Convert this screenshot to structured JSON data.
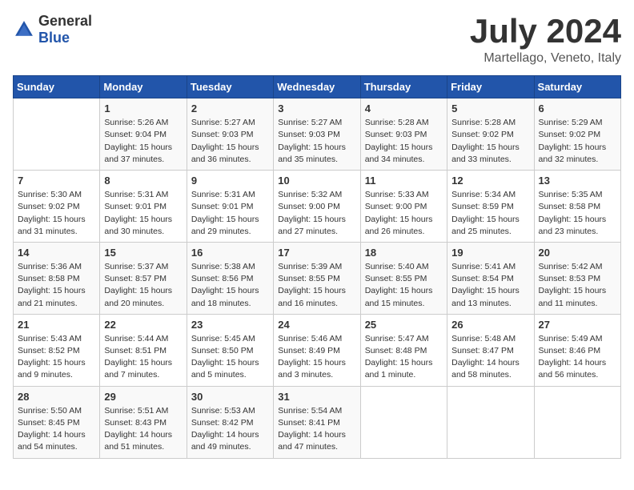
{
  "logo": {
    "general": "General",
    "blue": "Blue"
  },
  "header": {
    "month": "July 2024",
    "location": "Martellago, Veneto, Italy"
  },
  "weekdays": [
    "Sunday",
    "Monday",
    "Tuesday",
    "Wednesday",
    "Thursday",
    "Friday",
    "Saturday"
  ],
  "weeks": [
    [
      {
        "day": "",
        "info": ""
      },
      {
        "day": "1",
        "info": "Sunrise: 5:26 AM\nSunset: 9:04 PM\nDaylight: 15 hours\nand 37 minutes."
      },
      {
        "day": "2",
        "info": "Sunrise: 5:27 AM\nSunset: 9:03 PM\nDaylight: 15 hours\nand 36 minutes."
      },
      {
        "day": "3",
        "info": "Sunrise: 5:27 AM\nSunset: 9:03 PM\nDaylight: 15 hours\nand 35 minutes."
      },
      {
        "day": "4",
        "info": "Sunrise: 5:28 AM\nSunset: 9:03 PM\nDaylight: 15 hours\nand 34 minutes."
      },
      {
        "day": "5",
        "info": "Sunrise: 5:28 AM\nSunset: 9:02 PM\nDaylight: 15 hours\nand 33 minutes."
      },
      {
        "day": "6",
        "info": "Sunrise: 5:29 AM\nSunset: 9:02 PM\nDaylight: 15 hours\nand 32 minutes."
      }
    ],
    [
      {
        "day": "7",
        "info": "Sunrise: 5:30 AM\nSunset: 9:02 PM\nDaylight: 15 hours\nand 31 minutes."
      },
      {
        "day": "8",
        "info": "Sunrise: 5:31 AM\nSunset: 9:01 PM\nDaylight: 15 hours\nand 30 minutes."
      },
      {
        "day": "9",
        "info": "Sunrise: 5:31 AM\nSunset: 9:01 PM\nDaylight: 15 hours\nand 29 minutes."
      },
      {
        "day": "10",
        "info": "Sunrise: 5:32 AM\nSunset: 9:00 PM\nDaylight: 15 hours\nand 27 minutes."
      },
      {
        "day": "11",
        "info": "Sunrise: 5:33 AM\nSunset: 9:00 PM\nDaylight: 15 hours\nand 26 minutes."
      },
      {
        "day": "12",
        "info": "Sunrise: 5:34 AM\nSunset: 8:59 PM\nDaylight: 15 hours\nand 25 minutes."
      },
      {
        "day": "13",
        "info": "Sunrise: 5:35 AM\nSunset: 8:58 PM\nDaylight: 15 hours\nand 23 minutes."
      }
    ],
    [
      {
        "day": "14",
        "info": "Sunrise: 5:36 AM\nSunset: 8:58 PM\nDaylight: 15 hours\nand 21 minutes."
      },
      {
        "day": "15",
        "info": "Sunrise: 5:37 AM\nSunset: 8:57 PM\nDaylight: 15 hours\nand 20 minutes."
      },
      {
        "day": "16",
        "info": "Sunrise: 5:38 AM\nSunset: 8:56 PM\nDaylight: 15 hours\nand 18 minutes."
      },
      {
        "day": "17",
        "info": "Sunrise: 5:39 AM\nSunset: 8:55 PM\nDaylight: 15 hours\nand 16 minutes."
      },
      {
        "day": "18",
        "info": "Sunrise: 5:40 AM\nSunset: 8:55 PM\nDaylight: 15 hours\nand 15 minutes."
      },
      {
        "day": "19",
        "info": "Sunrise: 5:41 AM\nSunset: 8:54 PM\nDaylight: 15 hours\nand 13 minutes."
      },
      {
        "day": "20",
        "info": "Sunrise: 5:42 AM\nSunset: 8:53 PM\nDaylight: 15 hours\nand 11 minutes."
      }
    ],
    [
      {
        "day": "21",
        "info": "Sunrise: 5:43 AM\nSunset: 8:52 PM\nDaylight: 15 hours\nand 9 minutes."
      },
      {
        "day": "22",
        "info": "Sunrise: 5:44 AM\nSunset: 8:51 PM\nDaylight: 15 hours\nand 7 minutes."
      },
      {
        "day": "23",
        "info": "Sunrise: 5:45 AM\nSunset: 8:50 PM\nDaylight: 15 hours\nand 5 minutes."
      },
      {
        "day": "24",
        "info": "Sunrise: 5:46 AM\nSunset: 8:49 PM\nDaylight: 15 hours\nand 3 minutes."
      },
      {
        "day": "25",
        "info": "Sunrise: 5:47 AM\nSunset: 8:48 PM\nDaylight: 15 hours\nand 1 minute."
      },
      {
        "day": "26",
        "info": "Sunrise: 5:48 AM\nSunset: 8:47 PM\nDaylight: 14 hours\nand 58 minutes."
      },
      {
        "day": "27",
        "info": "Sunrise: 5:49 AM\nSunset: 8:46 PM\nDaylight: 14 hours\nand 56 minutes."
      }
    ],
    [
      {
        "day": "28",
        "info": "Sunrise: 5:50 AM\nSunset: 8:45 PM\nDaylight: 14 hours\nand 54 minutes."
      },
      {
        "day": "29",
        "info": "Sunrise: 5:51 AM\nSunset: 8:43 PM\nDaylight: 14 hours\nand 51 minutes."
      },
      {
        "day": "30",
        "info": "Sunrise: 5:53 AM\nSunset: 8:42 PM\nDaylight: 14 hours\nand 49 minutes."
      },
      {
        "day": "31",
        "info": "Sunrise: 5:54 AM\nSunset: 8:41 PM\nDaylight: 14 hours\nand 47 minutes."
      },
      {
        "day": "",
        "info": ""
      },
      {
        "day": "",
        "info": ""
      },
      {
        "day": "",
        "info": ""
      }
    ]
  ]
}
